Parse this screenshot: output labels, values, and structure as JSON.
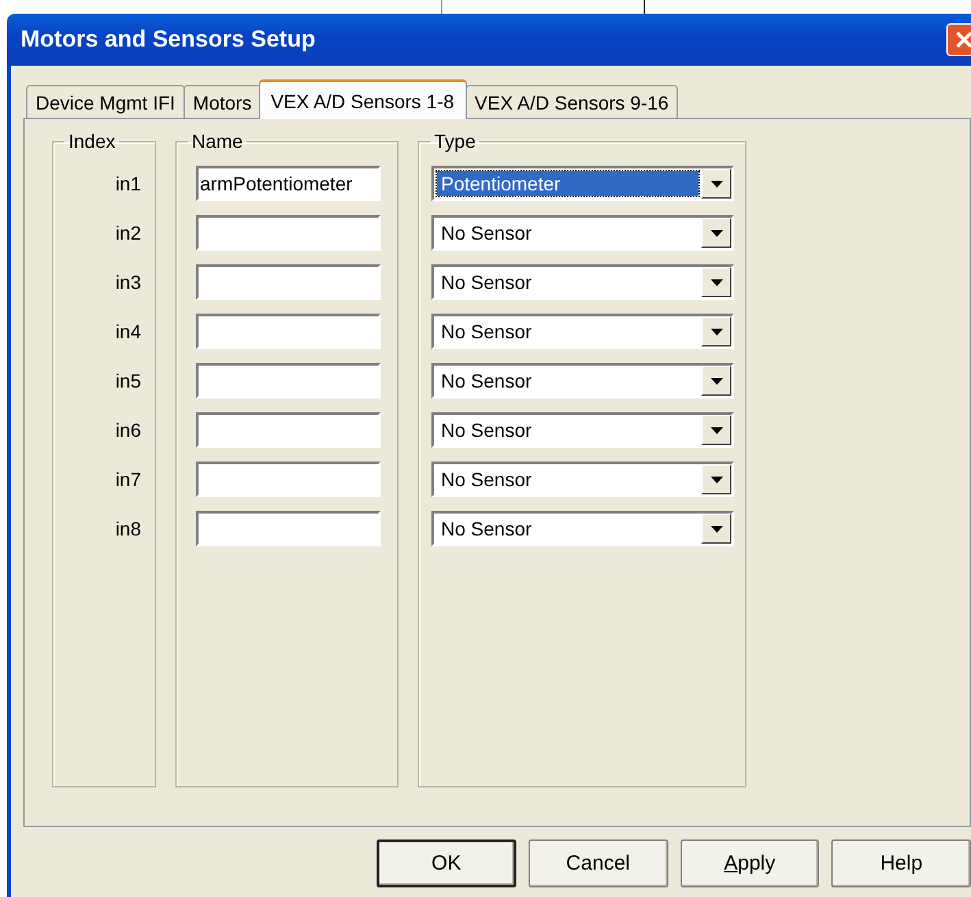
{
  "window": {
    "title": "Motors and Sensors Setup"
  },
  "tabs": [
    {
      "label": "Device Mgmt IFI",
      "selected": false
    },
    {
      "label": "Motors",
      "selected": false
    },
    {
      "label": "VEX A/D Sensors 1-8",
      "selected": true
    },
    {
      "label": "VEX A/D Sensors 9-16",
      "selected": false
    }
  ],
  "groups": {
    "index": "Index",
    "name": "Name",
    "type": "Type"
  },
  "rows": [
    {
      "index": "in1",
      "name": "armPotentiometer",
      "type": "Potentiometer",
      "focused": true
    },
    {
      "index": "in2",
      "type": "No Sensor",
      "focused": false
    },
    {
      "index": "in3",
      "type": "No Sensor",
      "focused": false
    },
    {
      "index": "in4",
      "type": "No Sensor",
      "focused": false
    },
    {
      "index": "in5",
      "type": "No Sensor",
      "focused": false
    },
    {
      "index": "in6",
      "type": "No Sensor",
      "focused": false
    },
    {
      "index": "in7",
      "type": "No Sensor",
      "focused": false
    },
    {
      "index": "in8",
      "type": "No Sensor",
      "focused": false
    }
  ],
  "buttons": [
    {
      "label": "OK",
      "default": true,
      "mnemonic": false
    },
    {
      "label": "Cancel",
      "default": false,
      "mnemonic": false
    },
    {
      "label": "Apply",
      "default": false,
      "mnemonic": true
    },
    {
      "label": "Help",
      "default": false,
      "mnemonic": false
    }
  ]
}
